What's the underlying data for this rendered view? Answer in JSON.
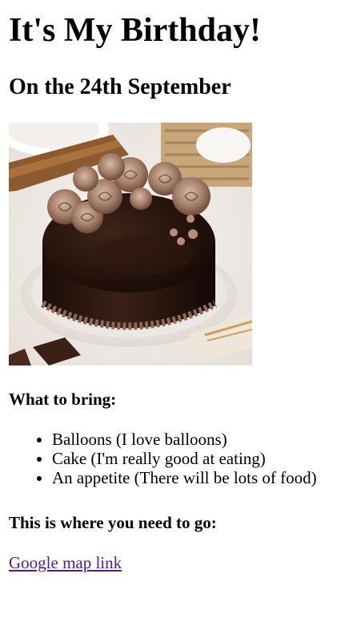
{
  "title": "It's My Birthday!",
  "date_heading": "On the 24th September",
  "image": {
    "name": "chocolate cake with rose frosting"
  },
  "bring": {
    "heading": "What to bring:",
    "items": [
      "Balloons (I love balloons)",
      "Cake (I'm really good at eating)",
      "An appetite (There will be lots of food)"
    ]
  },
  "location": {
    "heading": "This is where you need to go:",
    "link_label": "Google map link"
  },
  "colors": {
    "link_visited": "#551a8b",
    "text": "#000000",
    "background": "#ffffff"
  }
}
